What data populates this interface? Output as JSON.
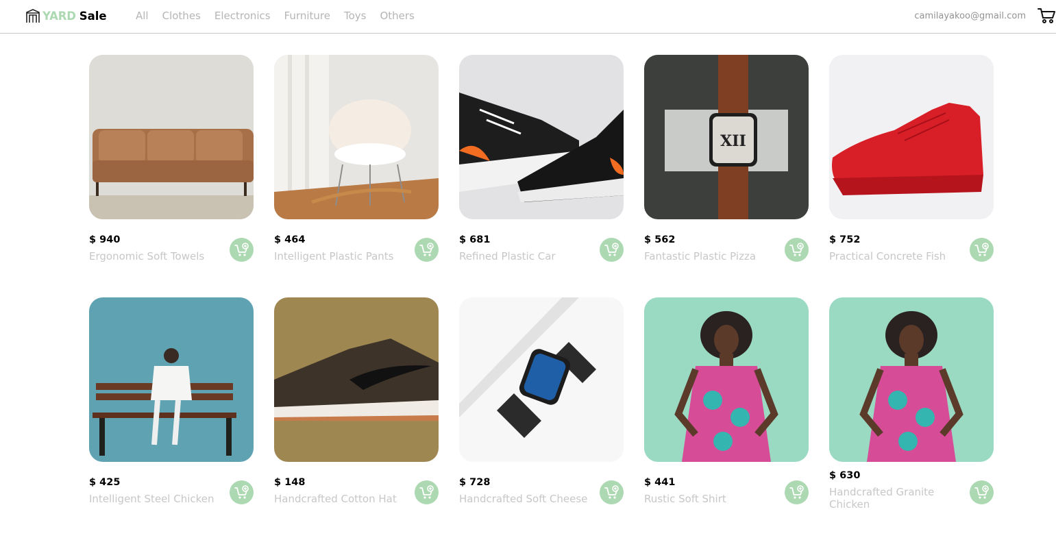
{
  "brand": {
    "yard": "YARD",
    "sale": "Sale"
  },
  "nav": {
    "links": [
      "All",
      "Clothes",
      "Electronics",
      "Furniture",
      "Toys",
      "Others"
    ],
    "email": "camilayakoo@gmail.com"
  },
  "icons": {
    "logo": "storefront-icon",
    "cart": "shopping-cart-icon",
    "add_to_cart": "add-to-cart-icon"
  },
  "colors": {
    "accent": "#acd9b2",
    "nav_text": "#b5b5b5",
    "product_name": "#c7c7c7"
  },
  "products": [
    {
      "price": "$ 940",
      "name": "Ergonomic Soft Towels"
    },
    {
      "price": "$ 464",
      "name": "Intelligent Plastic Pants"
    },
    {
      "price": "$ 681",
      "name": "Refined Plastic Car"
    },
    {
      "price": "$ 562",
      "name": "Fantastic Plastic Pizza"
    },
    {
      "price": "$ 752",
      "name": "Practical Concrete Fish"
    },
    {
      "price": "$ 425",
      "name": "Intelligent Steel Chicken"
    },
    {
      "price": "$ 148",
      "name": "Handcrafted Cotton Hat"
    },
    {
      "price": "$ 728",
      "name": "Handcrafted Soft Cheese"
    },
    {
      "price": "$ 441",
      "name": "Rustic Soft Shirt"
    },
    {
      "price": "$ 630",
      "name": "Handcrafted Granite Chicken"
    }
  ]
}
